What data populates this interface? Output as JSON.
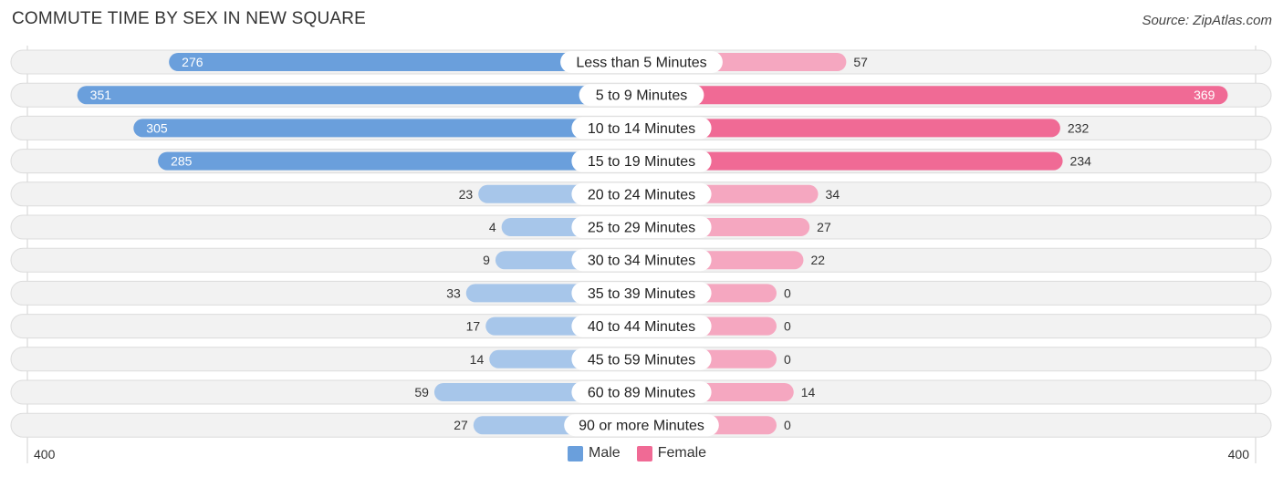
{
  "title": "COMMUTE TIME BY SEX IN NEW SQUARE",
  "source": "Source: ZipAtlas.com",
  "colors": {
    "male_strong": "#6a9fdc",
    "male_light": "#a7c6ea",
    "female_strong": "#f06a95",
    "female_light": "#f5a7c0"
  },
  "legend": {
    "male_label": "Male",
    "female_label": "Female"
  },
  "axis": {
    "left_tick": "400",
    "right_tick": "400"
  },
  "chart_data": {
    "type": "bar",
    "orientation": "horizontal-diverging",
    "title": "COMMUTE TIME BY SEX IN NEW SQUARE",
    "categories": [
      "Less than 5 Minutes",
      "5 to 9 Minutes",
      "10 to 14 Minutes",
      "15 to 19 Minutes",
      "20 to 24 Minutes",
      "25 to 29 Minutes",
      "30 to 34 Minutes",
      "35 to 39 Minutes",
      "40 to 44 Minutes",
      "45 to 59 Minutes",
      "60 to 89 Minutes",
      "90 or more Minutes"
    ],
    "series": [
      {
        "name": "Male",
        "values": [
          276,
          351,
          305,
          285,
          23,
          4,
          9,
          33,
          17,
          14,
          59,
          27
        ]
      },
      {
        "name": "Female",
        "values": [
          57,
          369,
          232,
          234,
          34,
          27,
          22,
          0,
          0,
          0,
          14,
          0
        ]
      }
    ],
    "xlim": [
      -400,
      400
    ],
    "xlabel": "",
    "ylabel": "",
    "legend_position": "bottom-center",
    "grid": false
  }
}
